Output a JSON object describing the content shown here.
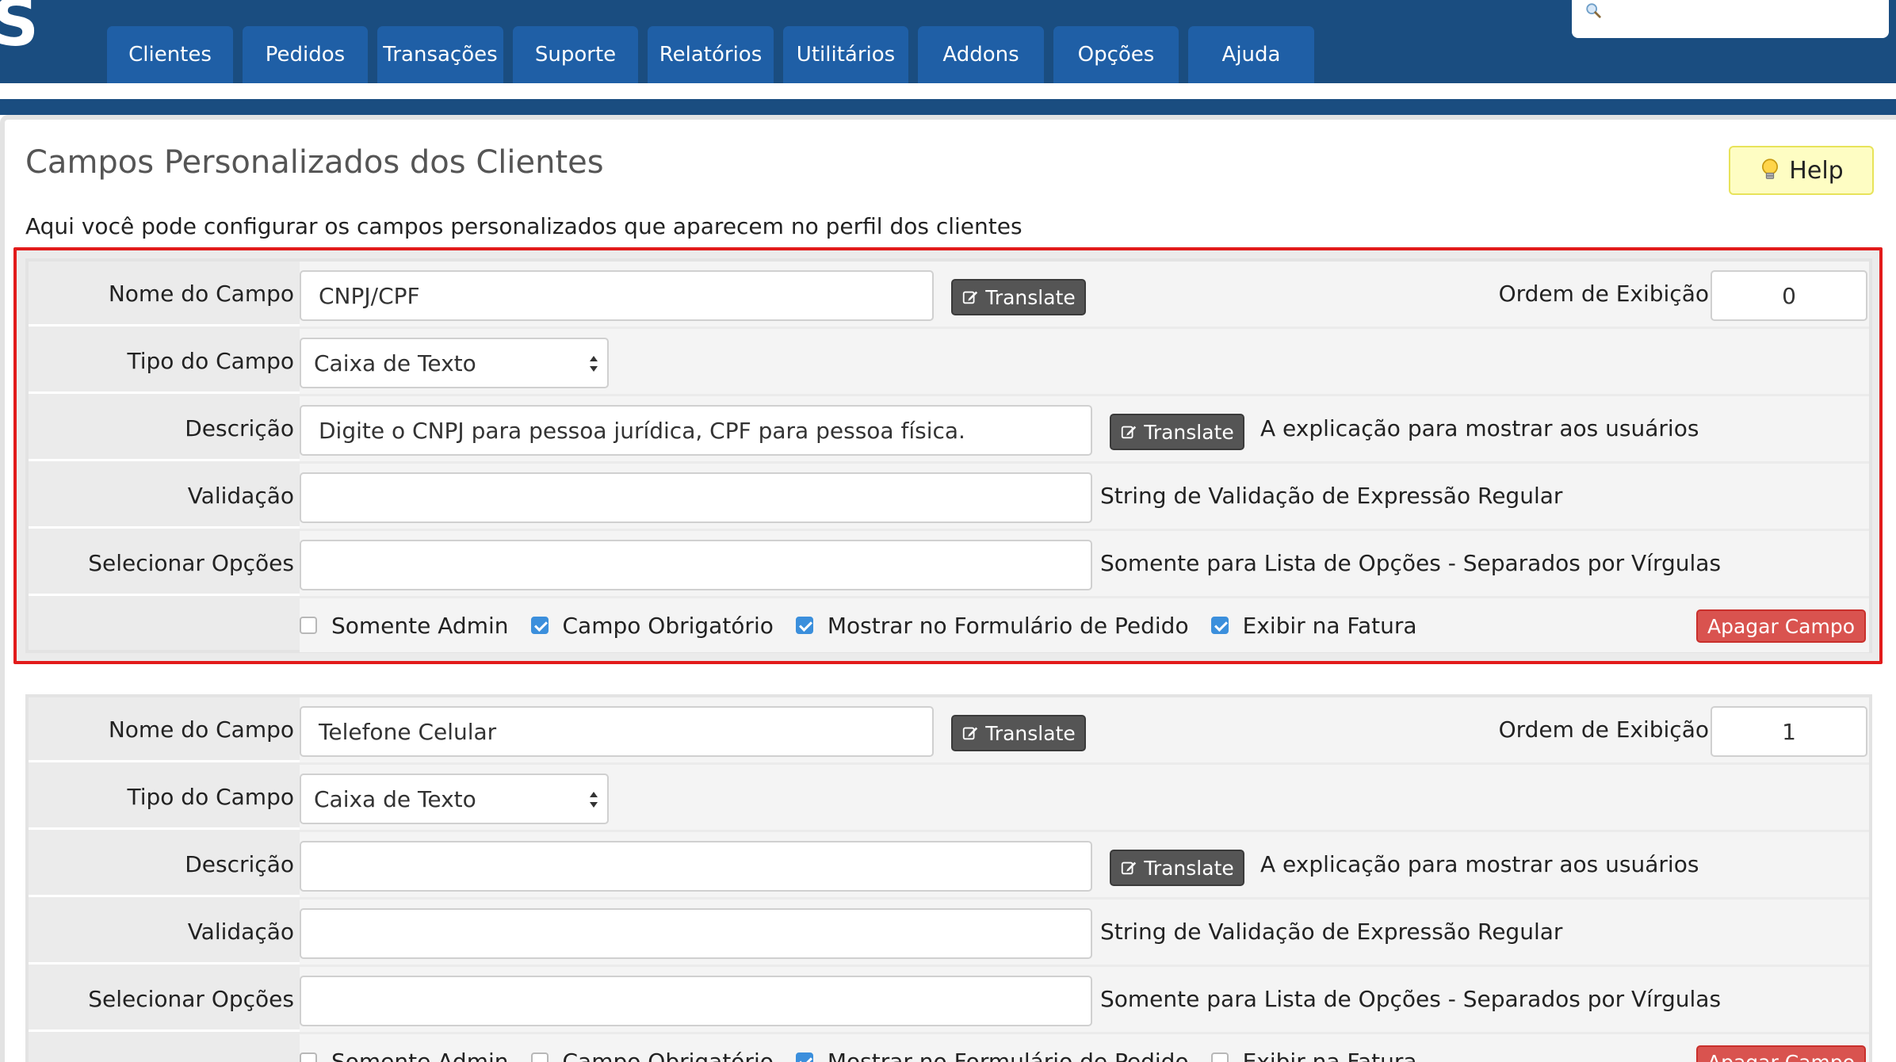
{
  "header": {
    "logo": "S",
    "nav": [
      {
        "label": "Clientes",
        "w": 0
      },
      {
        "label": "Pedidos"
      },
      {
        "label": "Transações"
      },
      {
        "label": "Suporte"
      },
      {
        "label": "Relatórios"
      },
      {
        "label": "Utilitários"
      },
      {
        "label": "Addons"
      },
      {
        "label": "Opções"
      },
      {
        "label": "Ajuda"
      }
    ],
    "search_placeholder": ""
  },
  "page": {
    "title": "Campos Personalizados dos Clientes",
    "help_label": "Help",
    "intro": "Aqui você pode configurar os campos personalizados que aparecem no perfil dos clientes"
  },
  "labels": {
    "field_name": "Nome do Campo",
    "field_type": "Tipo do Campo",
    "description": "Descrição",
    "validation": "Validação",
    "select_options": "Selecionar Opções",
    "translate": "Translate",
    "display_order": "Ordem de Exibição",
    "description_hint": "A explicação para mostrar aos usuários",
    "validation_hint": "String de Validação de Expressão Regular",
    "options_hint": "Somente para Lista de Opções - Separados por Vírgulas",
    "admin_only": "Somente Admin",
    "required": "Campo Obrigatório",
    "show_on_order": "Mostrar no Formulário de Pedido",
    "show_on_invoice": "Exibir na Fatura",
    "delete": "Apagar Campo"
  },
  "fields": [
    {
      "name": "CNPJ/CPF",
      "type": "Caixa de Texto",
      "description": "Digite o CNPJ para pessoa jurídica, CPF para pessoa física.",
      "validation": "",
      "options": "",
      "order": "0",
      "admin_only": false,
      "required": true,
      "show_on_order": true,
      "show_on_invoice": true
    },
    {
      "name": "Telefone Celular",
      "type": "Caixa de Texto",
      "description": "",
      "validation": "",
      "options": "",
      "order": "1",
      "admin_only": false,
      "required": false,
      "show_on_order": true,
      "show_on_invoice": false
    }
  ],
  "colors": {
    "header_bg": "#1a4d80",
    "nav_tab_bg": "#1f5fa6",
    "highlight_border": "#e21b1b",
    "checkbox_checked": "#3b8fdc",
    "delete_button": "#d9534f",
    "help_button_bg": "#fefdc3"
  }
}
